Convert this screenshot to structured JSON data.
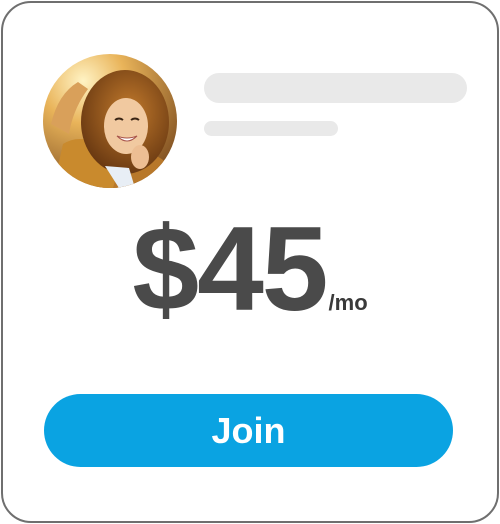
{
  "pricing_card": {
    "avatar_description": "profile-photo",
    "price": "$45",
    "period": "/mo",
    "join_label": "Join"
  },
  "colors": {
    "button": "#0aa3e2",
    "price_text": "#4a4a4a",
    "skeleton": "#e9e9e9",
    "card_border": "#6f6f6f"
  }
}
